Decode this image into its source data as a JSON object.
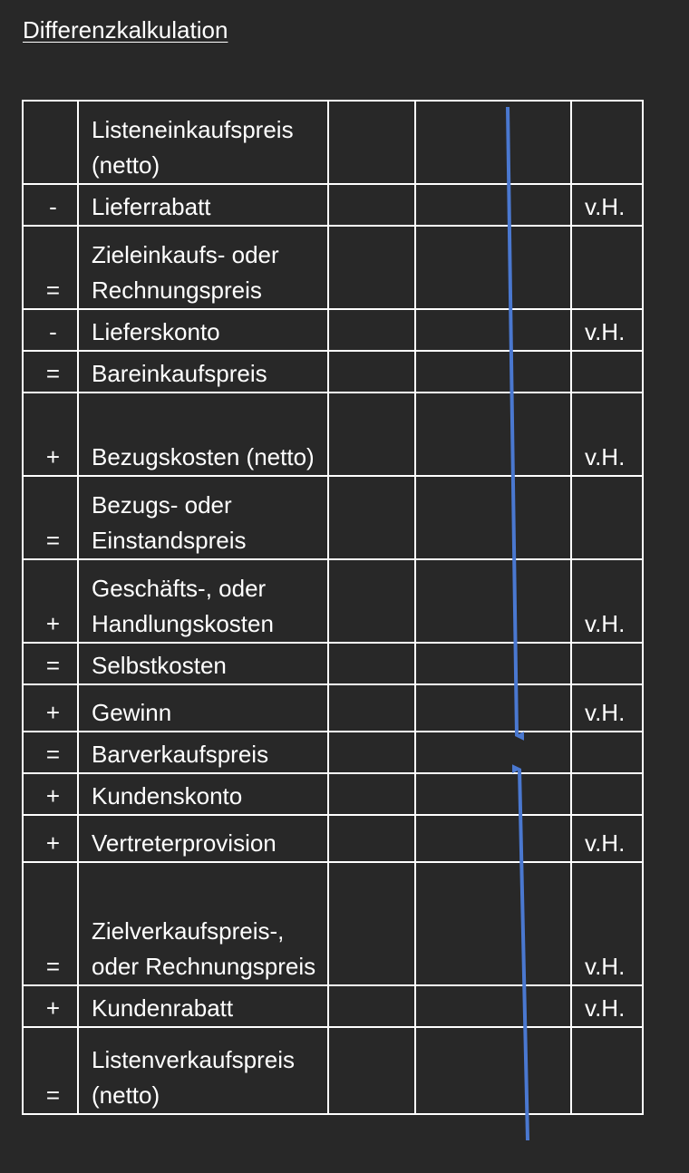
{
  "title": "Differenzkalkulation",
  "rows": [
    {
      "op": "",
      "label": "Listeneinkaufspreis (netto)",
      "unit": ""
    },
    {
      "op": "-",
      "label": "Lieferrabatt",
      "unit": "v.H."
    },
    {
      "op": "=",
      "label": "Zieleinkaufs- oder Rechnungspreis",
      "unit": ""
    },
    {
      "op": "-",
      "label": "Lieferskonto",
      "unit": "v.H."
    },
    {
      "op": "=",
      "label": "Bareinkaufspreis",
      "unit": ""
    },
    {
      "op": "+",
      "label": "Bezugskosten (netto)",
      "unit": "v.H."
    },
    {
      "op": "=",
      "label": "Bezugs- oder Einstandspreis",
      "unit": ""
    },
    {
      "op": "+",
      "label": "Geschäfts-, oder Handlungskosten",
      "unit": "v.H."
    },
    {
      "op": "=",
      "label": "Selbstkosten",
      "unit": ""
    },
    {
      "op": "+",
      "label": "Gewinn",
      "unit": "v.H."
    },
    {
      "op": "=",
      "label": "Barverkaufspreis",
      "unit": ""
    },
    {
      "op": "+",
      "label": "Kundenskonto",
      "unit": ""
    },
    {
      "op": "+",
      "label": "Vertreterprovision",
      "unit": "v.H."
    },
    {
      "op": "=",
      "label": "Zielverkaufspreis-, oder Rechnungspreis",
      "unit": "v.H."
    },
    {
      "op": "+",
      "label": "Kundenrabatt",
      "unit": "v.H."
    },
    {
      "op": "=",
      "label": "Listenverkaufspreis (netto)",
      "unit": ""
    }
  ],
  "arrow_color": "#4a78d0"
}
